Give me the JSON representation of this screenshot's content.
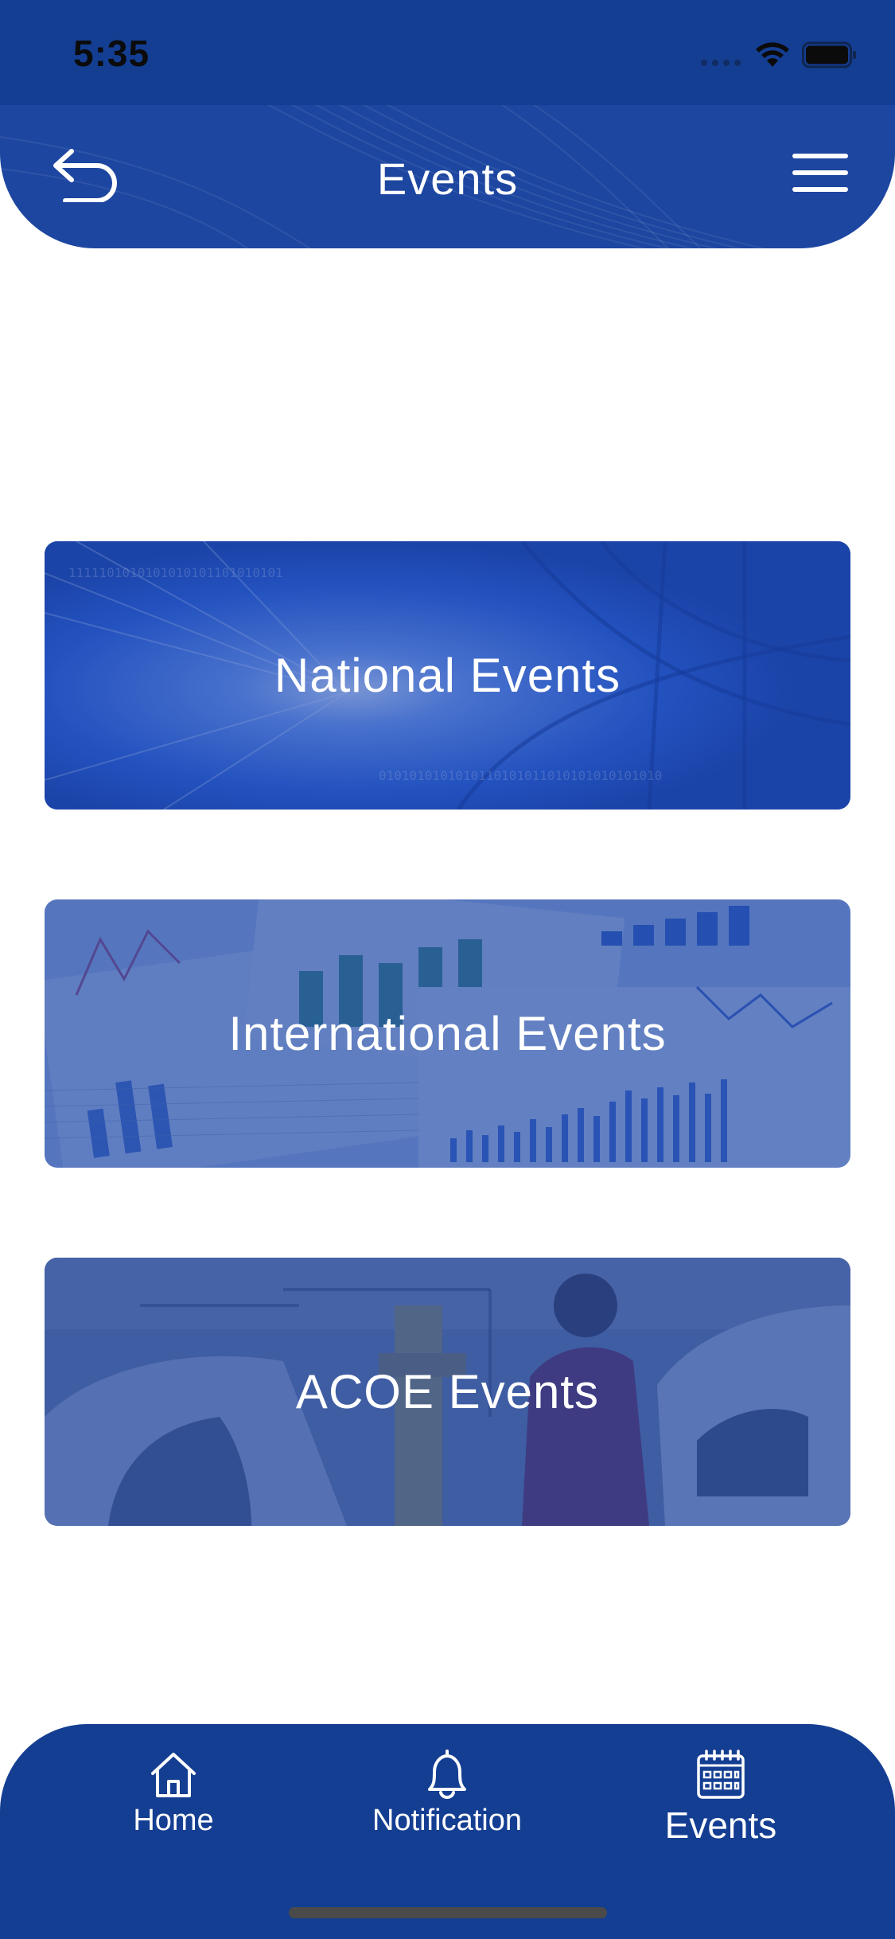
{
  "status_bar": {
    "time": "5:35"
  },
  "header": {
    "title": "Events",
    "back_icon": "back-arrow-icon",
    "menu_icon": "hamburger-menu-icon"
  },
  "cards": [
    {
      "label": "National Events"
    },
    {
      "label": "International Events"
    },
    {
      "label": "ACOE Events"
    }
  ],
  "tab_bar": {
    "tabs": [
      {
        "label": "Home",
        "icon": "home-icon"
      },
      {
        "label": "Notification",
        "icon": "bell-icon"
      },
      {
        "label": "Events",
        "icon": "calendar-icon"
      }
    ]
  },
  "colors": {
    "brand_blue": "#143e92",
    "header_blue": "#1d46a0",
    "text_white": "#ffffff"
  }
}
